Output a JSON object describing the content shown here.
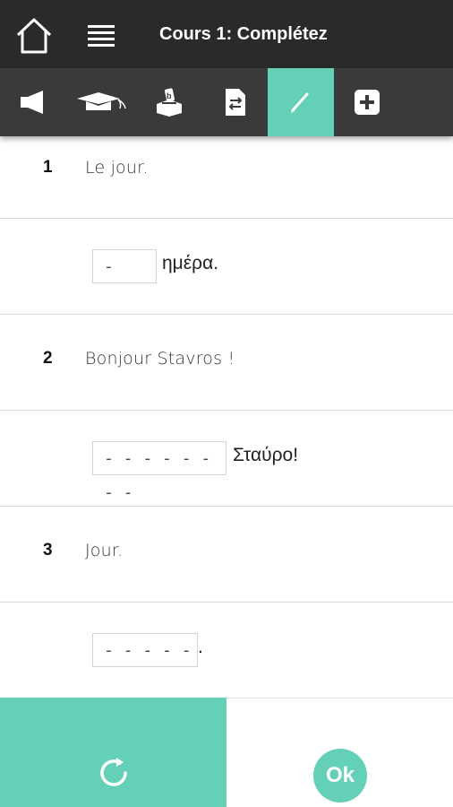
{
  "header": {
    "title": "Cours 1: Complétez",
    "home_icon": "home-icon",
    "menu_icon": "hamburger-menu-icon"
  },
  "tabs": [
    {
      "icon": "megaphone-icon",
      "active": false
    },
    {
      "icon": "graduation-cap-icon",
      "active": false
    },
    {
      "icon": "ballot-box-icon",
      "active": false
    },
    {
      "icon": "document-swap-icon",
      "active": false
    },
    {
      "icon": "pencil-icon",
      "active": true
    },
    {
      "icon": "plus-square-icon",
      "active": false
    }
  ],
  "questions": [
    {
      "number": "1",
      "prompt": "Le jour.",
      "answer_placeholder": "-",
      "suffix": "ημέρα."
    },
    {
      "number": "2",
      "prompt": "Bonjour Stavros !",
      "answer_placeholder": "- - - - - - - -",
      "suffix": "Σταύρο!"
    },
    {
      "number": "3",
      "prompt": "Jour.",
      "answer_placeholder": "- - - - -",
      "suffix": "."
    }
  ],
  "footer": {
    "reset_icon": "refresh-icon",
    "ok_label": "Ok"
  },
  "colors": {
    "accent": "#64d0b7",
    "topbar": "#2a2a2a",
    "tabbar": "#3a3a3a"
  }
}
